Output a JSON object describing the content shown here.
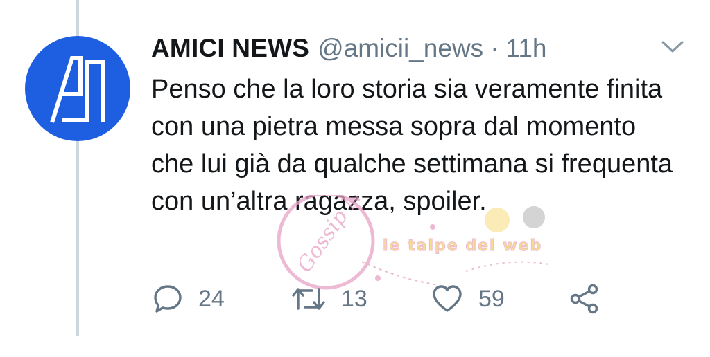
{
  "tweet": {
    "author_name": "AMICI NEWS",
    "handle": "@amicii_news",
    "separator": "·",
    "time": "11h",
    "text": "Penso che la loro storia sia veramente finita con una pietra messa sopra dal momento che lui già da qualche settimana si frequenta con un’altra ragazza, spoiler.",
    "avatar_icon": "amici-news-logo",
    "avatar_color": "#1d5fe0"
  },
  "actions": {
    "reply_count": "24",
    "retweet_count": "13",
    "like_count": "59"
  },
  "icons": {
    "caret": "chevron-down-icon",
    "reply": "reply-icon",
    "retweet": "retweet-icon",
    "like": "heart-icon",
    "share": "share-icon"
  },
  "watermark": {
    "text": "le talpe del web",
    "stamp_text": "Gossip News"
  },
  "colors": {
    "text_primary": "#14171a",
    "text_secondary": "#657786",
    "thread_line": "#ccd6dd",
    "watermark_pink": "#e8a4c6"
  }
}
